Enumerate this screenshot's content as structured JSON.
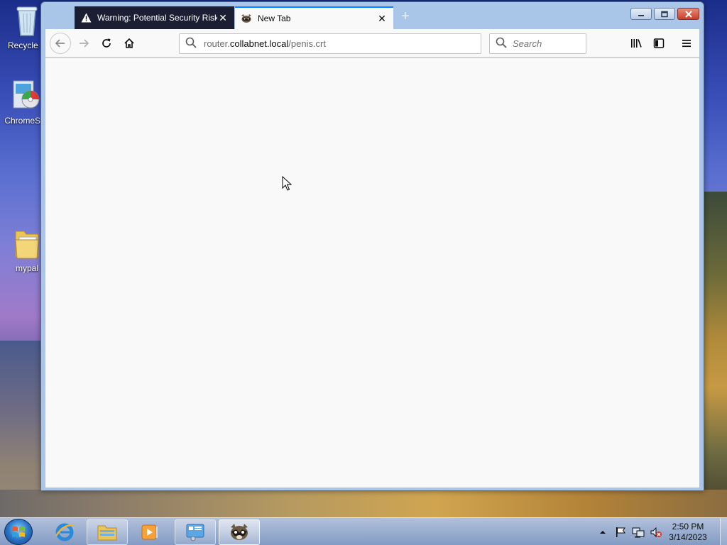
{
  "desktop": {
    "icons": [
      {
        "label": "Recycle B",
        "icon": "recycle-bin-icon"
      },
      {
        "label": "ChromeSe",
        "icon": "setup-disc-icon"
      },
      {
        "label": "mypal",
        "icon": "folder-icon"
      }
    ]
  },
  "browser": {
    "tabs": [
      {
        "title": "Warning: Potential Security Risk",
        "icon": "warning-icon",
        "close": "✕"
      },
      {
        "title": "New Tab",
        "icon": "raccoon-icon",
        "close": "✕"
      }
    ],
    "new_tab": "+",
    "url": {
      "prefix": "router.",
      "domain": "collabnet.local",
      "path": "/penis.crt"
    },
    "search": {
      "placeholder": "Search"
    }
  },
  "taskbar": {
    "apps": [
      "internet-explorer-icon",
      "file-explorer-icon",
      "media-player-icon",
      "control-panel-icon",
      "mypal-browser-icon"
    ],
    "clock": {
      "time": "2:50 PM",
      "date": "3/14/2023"
    },
    "tray": [
      "show-hidden-icons-icon",
      "action-center-flag-icon",
      "network-icon",
      "volume-muted-icon"
    ]
  },
  "colors": {
    "tab_accent": "#0a84ff",
    "warn_tab_bg": "#1c1f33",
    "window_frame": "#a9c6e8",
    "content_bg": "#f9f9fa"
  }
}
